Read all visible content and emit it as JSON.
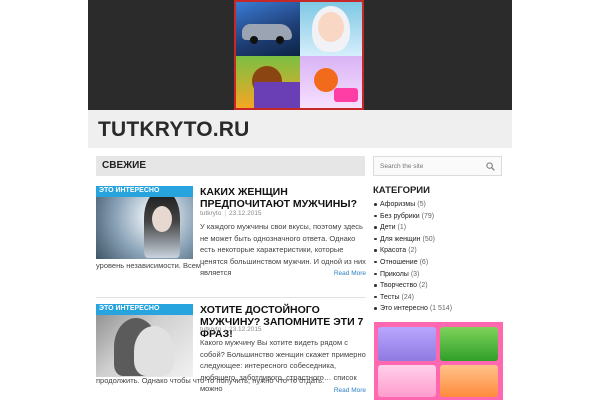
{
  "site": {
    "title": "TUTKRYTO.RU"
  },
  "feed": {
    "heading": "СВЕЖИЕ"
  },
  "posts": [
    {
      "tag": "ЭТО ИНТЕРЕСНО",
      "title": "КАКИХ ЖЕНЩИН ПРЕДПОЧИТАЮТ МУЖЧИНЫ?",
      "author": "tutkryto",
      "date": "23.12.2015",
      "excerpt": "У каждого мужчины свои вкусы, поэтому здесь не может быть однозначного ответа. Однако есть некоторые характеристики, которые ценятся большинством мужчин. И одной из них является",
      "excerpt_tail": "уровень независимости. Всем",
      "read_more": "Read More"
    },
    {
      "tag": "ЭТО ИНТЕРЕСНО",
      "title": "ХОТИТЕ ДОСТОЙНОГО МУЖЧИНУ? ЗАПОМНИТЕ ЭТИ 7 ФРАЗ!",
      "author": "tutkryto",
      "date": "23.12.2015",
      "excerpt": "Какого мужчину Вы хотите видеть рядом с собой? Большинство женщин скажет примерно следующее: интересного собеседника, любящего, заботливого, страстного… список можно",
      "excerpt_tail": "продолжить. Однако чтобы что-то получить, нужно что-то отдать.",
      "read_more": "Read More"
    }
  ],
  "sidebar": {
    "search_placeholder": "Search the site",
    "categories_heading": "КАТЕГОРИИ",
    "categories": [
      {
        "name": "Афоризмы",
        "count": "(5)"
      },
      {
        "name": "Без рубрики",
        "count": "(79)"
      },
      {
        "name": "Дети",
        "count": "(1)"
      },
      {
        "name": "Для женщин",
        "count": "(50)"
      },
      {
        "name": "Красота",
        "count": "(2)"
      },
      {
        "name": "Отношение",
        "count": "(6)"
      },
      {
        "name": "Приколы",
        "count": "(3)"
      },
      {
        "name": "Творчество",
        "count": "(2)"
      },
      {
        "name": "Тесты",
        "count": "(24)"
      },
      {
        "name": "Это интересно",
        "count": "(1 514)"
      }
    ]
  },
  "colors": {
    "tag": "#27a4dd",
    "read_more": "#2e80c5",
    "top_band": "#2b2b2b"
  }
}
